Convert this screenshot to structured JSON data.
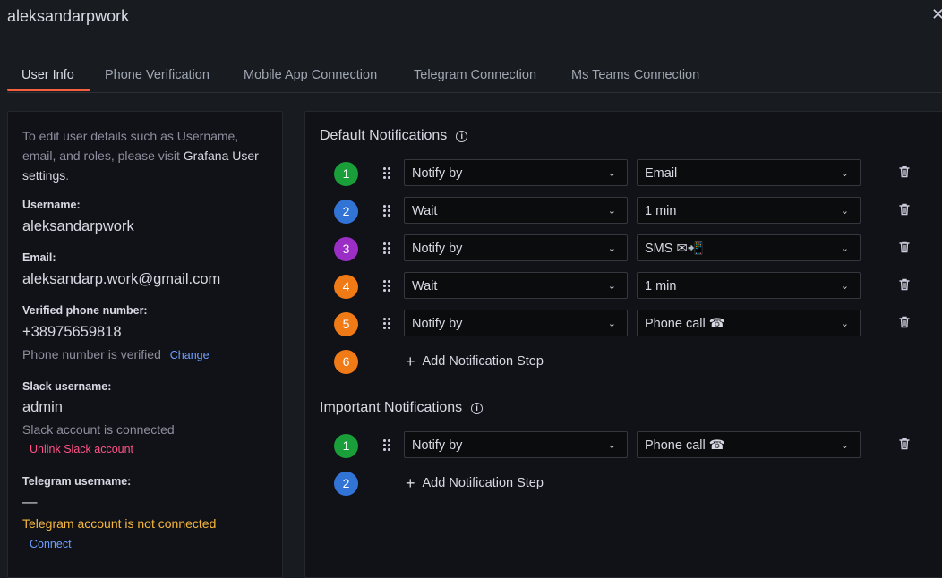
{
  "window": {
    "title": "aleksandarpwork",
    "close_glyph": "✕"
  },
  "tabs": [
    {
      "label": "User Info",
      "active": true
    },
    {
      "label": "Phone Verification",
      "active": false
    },
    {
      "label": "Mobile App Connection",
      "active": false
    },
    {
      "label": "Telegram Connection",
      "active": false
    },
    {
      "label": "Ms Teams Connection",
      "active": false
    }
  ],
  "user_info": {
    "intro_prefix": "To edit user details such as Username, email, and roles, please visit",
    "intro_link": "Grafana User settings",
    "intro_suffix": ".",
    "username_label": "Username:",
    "username": "aleksandarpwork",
    "email_label": "Email:",
    "email": "aleksandarp.work@gmail.com",
    "phone_label": "Verified phone number:",
    "phone": "+38975659818",
    "phone_status": "Phone number is verified",
    "phone_change": "Change",
    "slack_label": "Slack username:",
    "slack_username": "admin",
    "slack_status": "Slack account is connected",
    "slack_unlink": "Unlink Slack account",
    "telegram_label": "Telegram username:",
    "telegram_username": "—",
    "telegram_status": "Telegram account is not connected",
    "telegram_connect": "Connect"
  },
  "default_notifications": {
    "title": "Default Notifications",
    "steps": [
      {
        "num": "1",
        "color": "#1a9e3a",
        "action": "Notify by",
        "value": "Email"
      },
      {
        "num": "2",
        "color": "#3273d6",
        "action": "Wait",
        "value": "1 min"
      },
      {
        "num": "3",
        "color": "#9b2fc5",
        "action": "Notify by",
        "value": "SMS ✉📲"
      },
      {
        "num": "4",
        "color": "#ef7a16",
        "action": "Wait",
        "value": "1 min"
      },
      {
        "num": "5",
        "color": "#ef7a16",
        "action": "Notify by",
        "value": "Phone call ☎"
      }
    ],
    "add_num": "6",
    "add_color": "#ef7a16",
    "add_label": "Add Notification Step"
  },
  "important_notifications": {
    "title": "Important Notifications",
    "steps": [
      {
        "num": "1",
        "color": "#1a9e3a",
        "action": "Notify by",
        "value": "Phone call ☎"
      }
    ],
    "add_num": "2",
    "add_color": "#3273d6",
    "add_label": "Add Notification Step"
  },
  "icons": {
    "info": "info-circle-icon",
    "drag": "drag-handle-icon",
    "chevron": "chevron-down-icon",
    "trash": "trash-icon",
    "plus": "plus-icon",
    "close": "close-icon"
  },
  "colors": {
    "accent_tab": "#f55f3e",
    "link": "#6e9fff",
    "danger": "#ff5286",
    "warning": "#f5b73d"
  }
}
